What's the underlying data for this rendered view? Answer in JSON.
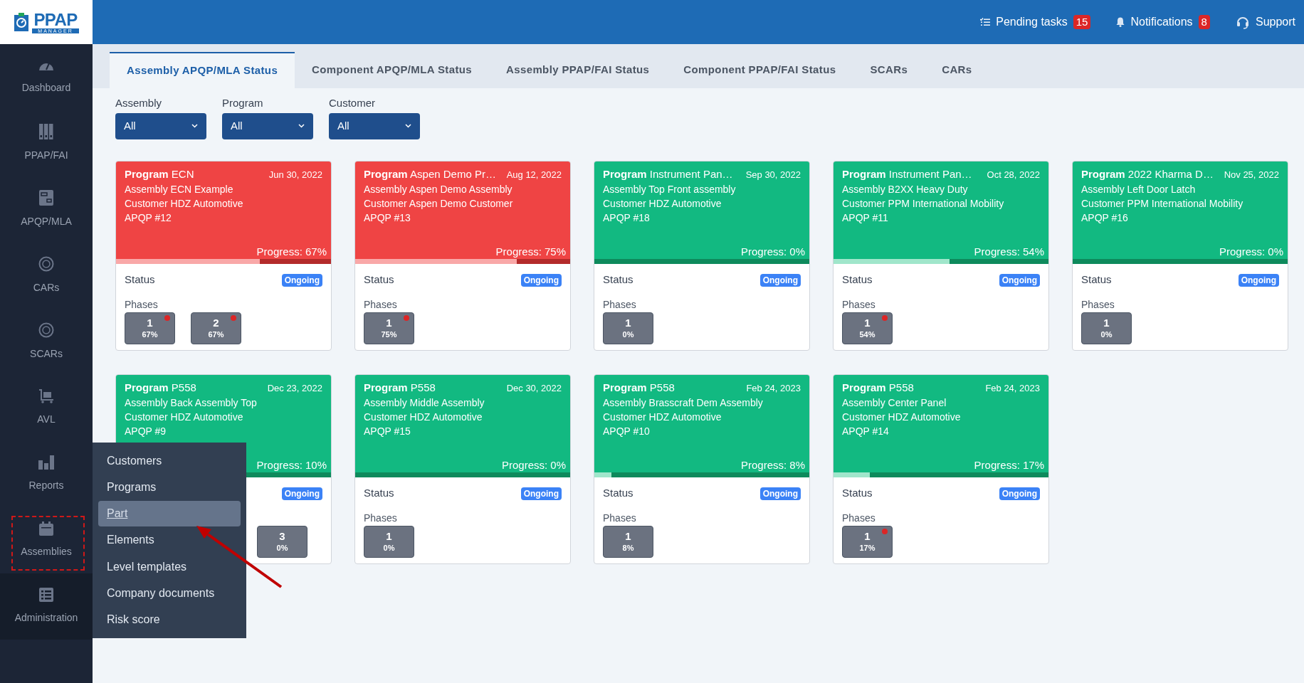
{
  "logo": {
    "title": "PPAP",
    "subtitle": "MANAGER"
  },
  "header": {
    "items": [
      {
        "kind": "tasks",
        "label": "Pending tasks",
        "count": "15"
      },
      {
        "kind": "bell",
        "label": "Notifications",
        "count": "8"
      },
      {
        "kind": "support",
        "label": "Support"
      }
    ]
  },
  "sidebar": {
    "items": [
      {
        "kind": "gauge",
        "label": "Dashboard",
        "selected": false
      },
      {
        "kind": "binders",
        "label": "PPAP/FAI",
        "selected": false
      },
      {
        "kind": "document",
        "label": "APQP/MLA",
        "selected": false
      },
      {
        "kind": "ring",
        "label": "CARs",
        "selected": false
      },
      {
        "kind": "ring",
        "label": "SCARs",
        "selected": false
      },
      {
        "kind": "cart",
        "label": "AVL",
        "selected": false
      },
      {
        "kind": "bars",
        "label": "Reports",
        "selected": false
      },
      {
        "kind": "calendar",
        "label": "Assemblies",
        "selected": false
      },
      {
        "kind": "list",
        "label": "Administration",
        "selected": true
      }
    ]
  },
  "submenu": {
    "items": [
      {
        "label": "Customers",
        "selected": false
      },
      {
        "label": "Programs",
        "selected": false
      },
      {
        "label": "Part",
        "selected": true
      },
      {
        "label": "Elements",
        "selected": false
      },
      {
        "label": "Level templates",
        "selected": false
      },
      {
        "label": "Company documents",
        "selected": false
      },
      {
        "label": "Risk score",
        "selected": false
      }
    ]
  },
  "tabs": [
    {
      "label": "Assembly APQP/MLA Status",
      "selected": true
    },
    {
      "label": "Component APQP/MLA Status",
      "selected": false
    },
    {
      "label": "Assembly PPAP/FAI Status",
      "selected": false
    },
    {
      "label": "Component PPAP/FAI Status",
      "selected": false
    },
    {
      "label": "SCARs",
      "selected": false
    },
    {
      "label": "CARs",
      "selected": false
    }
  ],
  "filters": [
    {
      "label": "Assembly",
      "value": "All"
    },
    {
      "label": "Program",
      "value": "All"
    },
    {
      "label": "Customer",
      "value": "All"
    }
  ],
  "cards": [
    {
      "kind": "late",
      "program_label": "Program",
      "program": "ECN",
      "date": "Jun 30, 2022",
      "assembly": "Assembly ECN Example",
      "customer": "Customer HDZ Automotive",
      "apqp": "APQP #12",
      "progress": "Progress: 67%",
      "level": 0.67,
      "status_label": "Status",
      "status": "Ongoing",
      "phases_label": "Phases",
      "phases": [
        {
          "number": "1",
          "percent": "67%",
          "alert": true
        },
        {
          "number": "2",
          "percent": "67%",
          "alert": true
        }
      ]
    },
    {
      "kind": "late",
      "program_label": "Program",
      "program": "Aspen Demo Pr…",
      "date": "Aug 12, 2022",
      "assembly": "Assembly Aspen Demo Assembly",
      "customer": "Customer Aspen Demo Customer",
      "apqp": "APQP #13",
      "progress": "Progress: 75%",
      "level": 0.75,
      "status_label": "Status",
      "status": "Ongoing",
      "phases_label": "Phases",
      "phases": [
        {
          "number": "1",
          "percent": "75%",
          "alert": true
        }
      ]
    },
    {
      "kind": "on_track",
      "program_label": "Program",
      "program": "Instrument Pan…",
      "date": "Sep 30, 2022",
      "assembly": "Assembly Top Front assembly",
      "customer": "Customer HDZ Automotive",
      "apqp": "APQP #18",
      "progress": "Progress: 0%",
      "level": 0,
      "status_label": "Status",
      "status": "Ongoing",
      "phases_label": "Phases",
      "phases": [
        {
          "number": "1",
          "percent": "0%",
          "alert": false
        }
      ]
    },
    {
      "kind": "on_track",
      "program_label": "Program",
      "program": "Instrument Pan…",
      "date": "Oct 28, 2022",
      "assembly": "Assembly B2XX Heavy Duty",
      "customer": "Customer PPM International Mobility",
      "apqp": "APQP #11",
      "progress": "Progress: 54%",
      "level": 0.54,
      "status_label": "Status",
      "status": "Ongoing",
      "phases_label": "Phases",
      "phases": [
        {
          "number": "1",
          "percent": "54%",
          "alert": true
        }
      ]
    },
    {
      "kind": "on_track",
      "program_label": "Program",
      "program": "2022 Kharma D…",
      "date": "Nov 25, 2022",
      "assembly": "Assembly Left Door Latch",
      "customer": "Customer PPM International Mobility",
      "apqp": "APQP #16",
      "progress": "Progress: 0%",
      "level": 0,
      "status_label": "Status",
      "status": "Ongoing",
      "phases_label": "Phases",
      "phases": [
        {
          "number": "1",
          "percent": "0%",
          "alert": false
        }
      ]
    },
    {
      "kind": "on_track",
      "program_label": "Program",
      "program": "P558",
      "date": "Dec 23, 2022",
      "assembly": "Assembly Back Assembly Top",
      "customer": "Customer HDZ Automotive",
      "apqp": "APQP #9",
      "progress": "Progress: 10%",
      "status": "Ongoing",
      "phases": [
        {
          "number": "3",
          "percent": "0%",
          "alert": false
        }
      ]
    },
    {
      "kind": "on_track",
      "program_label": "Program",
      "program": "P558",
      "date": "Dec 30, 2022",
      "assembly": "Assembly Middle Assembly",
      "customer": "Customer HDZ Automotive",
      "apqp": "APQP #15",
      "progress": "Progress: 0%",
      "level": 0,
      "status_label": "Status",
      "status": "Ongoing",
      "phases_label": "Phases",
      "phases": [
        {
          "number": "1",
          "percent": "0%",
          "alert": false
        }
      ]
    },
    {
      "kind": "on_track",
      "program_label": "Program",
      "program": "P558",
      "date": "Feb 24, 2023",
      "assembly": "Assembly Brasscraft Dem Assembly",
      "customer": "Customer HDZ Automotive",
      "apqp": "APQP #10",
      "progress": "Progress: 8%",
      "level": 0.08,
      "status_label": "Status",
      "status": "Ongoing",
      "phases_label": "Phases",
      "phases": [
        {
          "number": "1",
          "percent": "8%",
          "alert": false
        }
      ]
    },
    {
      "kind": "on_track",
      "program_label": "Program",
      "program": "P558",
      "date": "Feb 24, 2023",
      "assembly": "Assembly Center Panel",
      "customer": "Customer HDZ Automotive",
      "apqp": "APQP #14",
      "progress": "Progress: 17%",
      "level": 0.17,
      "status_label": "Status",
      "status": "Ongoing",
      "phases_label": "Phases",
      "phases": [
        {
          "number": "1",
          "percent": "17%",
          "alert": true
        }
      ]
    }
  ]
}
